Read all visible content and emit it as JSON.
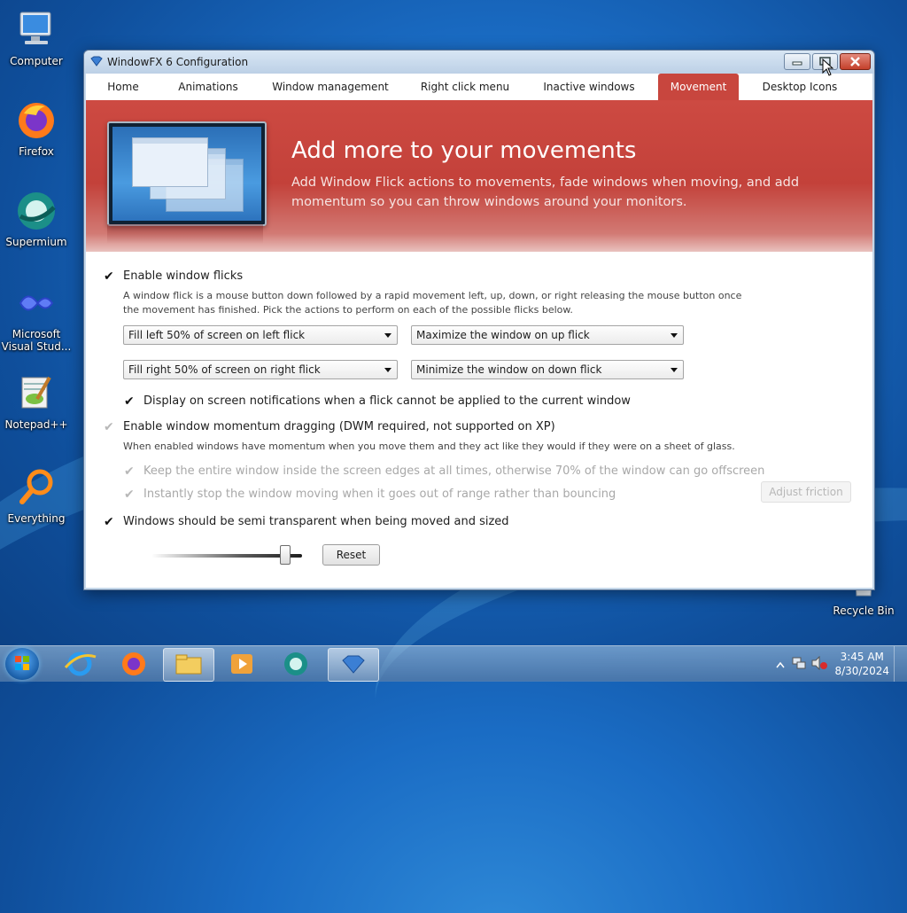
{
  "desktop": {
    "icons": [
      {
        "label": "Computer"
      },
      {
        "label": "Firefox"
      },
      {
        "label": "Supermium"
      },
      {
        "label": "Microsoft Visual Stud..."
      },
      {
        "label": "Notepad++"
      },
      {
        "label": "Everything"
      },
      {
        "label": "Recycle Bin"
      }
    ]
  },
  "window": {
    "title": "WindowFX 6 Configuration",
    "tabs": [
      {
        "label": "Home"
      },
      {
        "label": "Animations"
      },
      {
        "label": "Window management"
      },
      {
        "label": "Right click menu"
      },
      {
        "label": "Inactive windows"
      },
      {
        "label": "Movement",
        "active": true
      },
      {
        "label": "Desktop Icons"
      }
    ],
    "banner": {
      "title": "Add more to your movements",
      "description": "Add Window Flick actions to movements, fade windows when moving, and add momentum so you can throw windows around your monitors."
    },
    "flicks": {
      "enable_label": "Enable window flicks",
      "enabled": true,
      "description": "A window flick is a mouse button down followed by a rapid movement left, up, down, or right releasing the mouse button once the movement has finished.  Pick the actions to perform on each of the possible flicks below.",
      "left": "Fill left 50% of screen on left flick",
      "up": "Maximize the window on up flick",
      "right": "Fill right 50% of screen on right flick",
      "down": "Minimize the window on down flick",
      "notify_label": "Display on screen notifications when a flick cannot be applied to the current window",
      "notify_checked": true
    },
    "momentum": {
      "enable_label": "Enable window momentum dragging (DWM required, not supported on XP)",
      "enabled": false,
      "description": "When enabled windows have momentum when you move them and they act like they would if they were on a sheet of glass.",
      "keep_inside_label": "Keep the entire window inside the screen edges at all times, otherwise 70% of the window can go offscreen",
      "instant_stop_label": "Instantly stop the window moving when it goes out of range rather than bouncing",
      "adjust_friction_label": "Adjust friction"
    },
    "transparency": {
      "label": "Windows should be semi transparent when being moved and sized",
      "checked": true,
      "slider_value": 0.88,
      "reset_label": "Reset"
    }
  },
  "taskbar": {
    "clock_time": "3:45 AM",
    "clock_date": "8/30/2024"
  },
  "colors": {
    "accent_red": "#c8463e",
    "desktop_blue": "#1a6cc4"
  }
}
